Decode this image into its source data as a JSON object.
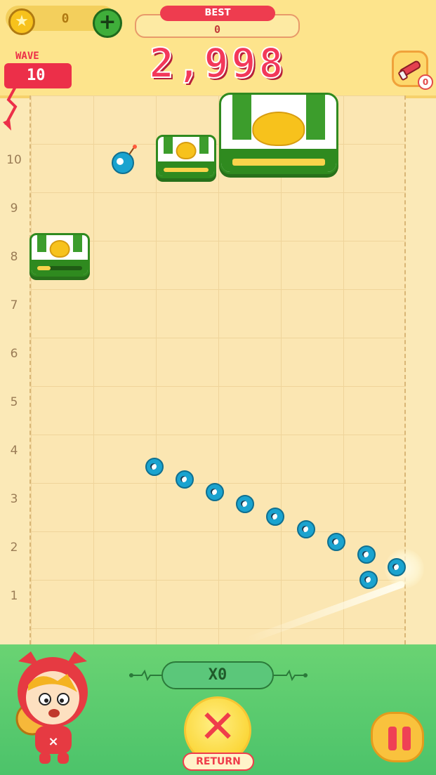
{
  "hud": {
    "coins": "0",
    "best_label": "BEST",
    "best_value": "0",
    "score": "2,998",
    "wave_label": "WAVE",
    "wave_value": "10",
    "item_count": "0"
  },
  "board": {
    "row_labels": [
      "10",
      "9",
      "8",
      "7",
      "6",
      "5",
      "4",
      "3",
      "2",
      "1"
    ],
    "blocks": [
      {
        "name": "small-block-wave10",
        "hp_fraction": 1.0
      },
      {
        "name": "big-boss-block",
        "hp_fraction": 1.0
      },
      {
        "name": "small-block-row8",
        "hp_fraction": 0.3
      }
    ]
  },
  "footer": {
    "multiplier": "X0",
    "return_label": "RETURN"
  },
  "colors": {
    "accent_red": "#ec2f49",
    "hud_yellow": "#fde48c",
    "block_green": "#2f8a1f",
    "footer_green": "#4cc36a",
    "ball_blue": "#1aa3cf"
  }
}
